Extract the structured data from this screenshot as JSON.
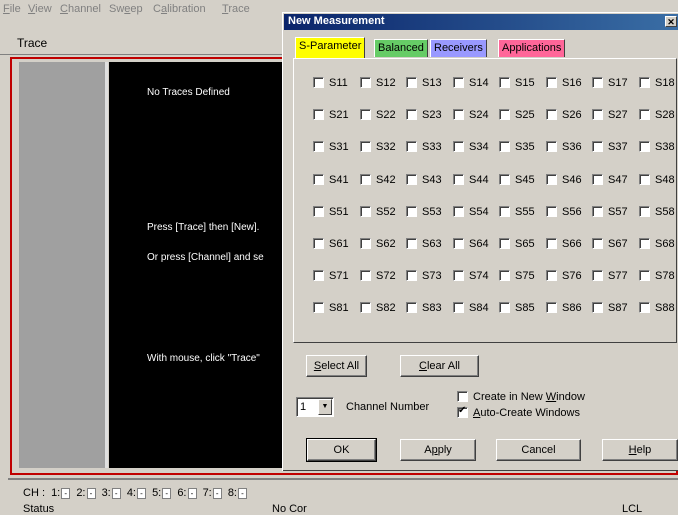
{
  "menu": [
    {
      "pre": "",
      "ul": "F",
      "post": "ile"
    },
    {
      "pre": "",
      "ul": "V",
      "post": "iew"
    },
    {
      "pre": "",
      "ul": "C",
      "post": "hannel"
    },
    {
      "pre": "Sw",
      "ul": "e",
      "post": "ep"
    },
    {
      "pre": "C",
      "ul": "a",
      "post": "libration"
    },
    {
      "pre": "",
      "ul": "T",
      "post": "race"
    }
  ],
  "trace_label": "Trace",
  "channel_window": {
    "messages": [
      "No Traces Defined",
      "Press [Trace] then [New].",
      "Or press [Channel] and se",
      "With mouse, click \"Trace\""
    ]
  },
  "channel_bar": {
    "prefix": "CH :",
    "channels": [
      {
        "num": "1:",
        "box": "-"
      },
      {
        "num": "2:",
        "box": "-"
      },
      {
        "num": "3:",
        "box": "-"
      },
      {
        "num": "4:",
        "box": "-"
      },
      {
        "num": "5:",
        "box": "-"
      },
      {
        "num": "6:",
        "box": "-"
      },
      {
        "num": "7:",
        "box": "-"
      },
      {
        "num": "8:",
        "box": "-"
      }
    ]
  },
  "status_bar": {
    "status": "Status",
    "correction": "No Cor",
    "lcl": "LCL"
  },
  "dialog": {
    "title": "New Measurement",
    "tabs": [
      {
        "label": "S-Parameter",
        "color": "#ffff00",
        "active": true
      },
      {
        "label": "Balanced",
        "color": "#66cc66",
        "active": false
      },
      {
        "label": "Receivers",
        "color": "#9999ff",
        "active": false
      },
      {
        "label": "Applications",
        "color": "#ff6699",
        "active": false
      }
    ],
    "s_parameters": [
      [
        "S11",
        "S12",
        "S13",
        "S14",
        "S15",
        "S16",
        "S17",
        "S18"
      ],
      [
        "S21",
        "S22",
        "S23",
        "S24",
        "S25",
        "S26",
        "S27",
        "S28"
      ],
      [
        "S31",
        "S32",
        "S33",
        "S34",
        "S35",
        "S36",
        "S37",
        "S38"
      ],
      [
        "S41",
        "S42",
        "S43",
        "S44",
        "S45",
        "S46",
        "S47",
        "S48"
      ],
      [
        "S51",
        "S52",
        "S53",
        "S54",
        "S55",
        "S56",
        "S57",
        "S58"
      ],
      [
        "S61",
        "S62",
        "S63",
        "S64",
        "S65",
        "S66",
        "S67",
        "S68"
      ],
      [
        "S71",
        "S72",
        "S73",
        "S74",
        "S75",
        "S76",
        "S77",
        "S78"
      ],
      [
        "S81",
        "S82",
        "S83",
        "S84",
        "S85",
        "S86",
        "S87",
        "S88"
      ]
    ],
    "select_all": {
      "ul": "S",
      "post": "elect All"
    },
    "clear_all": {
      "ul": "C",
      "post": "lear All"
    },
    "channel_number": {
      "value": "1",
      "label": "Channel Number"
    },
    "create_new_window": {
      "pre": "Create in New ",
      "ul": "W",
      "post": "indow",
      "checked": false
    },
    "auto_create_windows": {
      "pre": "",
      "ul": "A",
      "post": "uto-Create Windows",
      "checked": true
    },
    "buttons": {
      "ok": "OK",
      "apply": {
        "pre": "A",
        "ul": "p",
        "post": "ply"
      },
      "cancel": "Cancel",
      "help": {
        "pre": "",
        "ul": "H",
        "post": "elp"
      }
    }
  }
}
